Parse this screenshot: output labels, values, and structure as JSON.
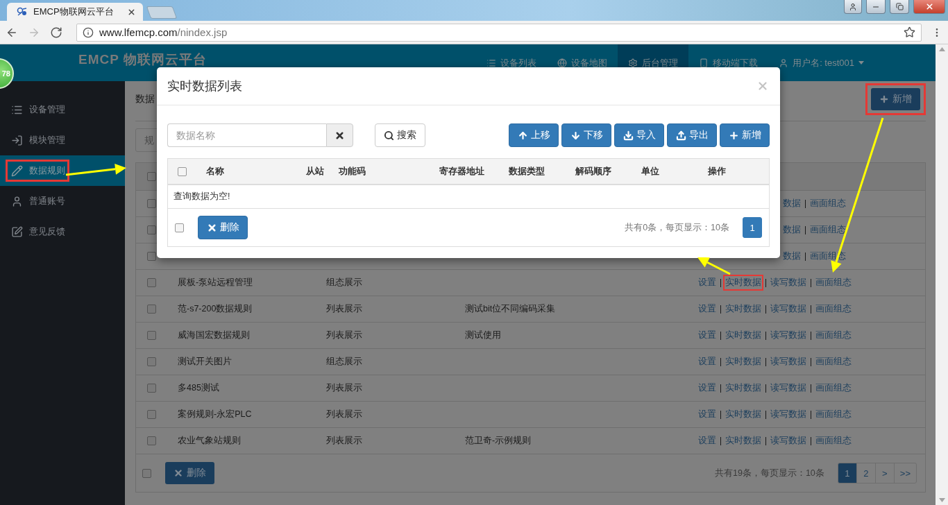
{
  "browser": {
    "tab": {
      "title": "EMCP物联网云平台"
    },
    "nav_buttons": [
      {
        "kind": "back",
        "disabled": false
      },
      {
        "kind": "forward",
        "disabled": true
      },
      {
        "kind": "reload",
        "disabled": false
      }
    ],
    "address": {
      "host": "www.lfemcp.com",
      "path": "/nindex.jsp"
    }
  },
  "floating_badge": "78",
  "navbar": {
    "logo": "EMCP 物联网云平台",
    "items": [
      {
        "kind": "list",
        "label": "设备列表",
        "selected": false
      },
      {
        "kind": "map",
        "label": "设备地图",
        "selected": false
      },
      {
        "kind": "admin",
        "label": "后台管理",
        "selected": true
      },
      {
        "kind": "mobile",
        "label": "移动端下载",
        "selected": false
      },
      {
        "kind": "user",
        "label": "用户名: test001",
        "selected": false
      }
    ]
  },
  "sidebar": {
    "items": [
      {
        "kind": "list",
        "label": "设备管理",
        "selected": false,
        "annotated": false
      },
      {
        "kind": "module",
        "label": "模块管理",
        "selected": false,
        "annotated": false
      },
      {
        "kind": "rule",
        "label": "数据规则",
        "selected": true,
        "annotated": true
      },
      {
        "kind": "account",
        "label": "普通账号",
        "selected": false,
        "annotated": false
      },
      {
        "kind": "feedback",
        "label": "意见反馈",
        "selected": false,
        "annotated": false
      }
    ]
  },
  "page": {
    "title": "数据",
    "filter_placeholder": "规",
    "add_button": {
      "label": "新增",
      "annotated": true
    },
    "table": {
      "select_all_checked": false,
      "rows": [
        {
          "kind": "covered",
          "checked": false,
          "ops": [
            {
              "label": "数据",
              "annotated": false
            },
            {
              "label": "画面组态",
              "annotated": false
            }
          ]
        },
        {
          "kind": "covered",
          "checked": false,
          "ops": [
            {
              "label": "数据",
              "annotated": false
            },
            {
              "label": "画面组态",
              "annotated": false
            }
          ]
        },
        {
          "kind": "covered",
          "checked": false,
          "ops": [
            {
              "label": "数据",
              "annotated": false
            },
            {
              "label": "画面组态",
              "annotated": false
            }
          ]
        },
        {
          "kind": "full",
          "checked": false,
          "name": "展板-泵站远程管理",
          "type": "组态展示",
          "ops": [
            {
              "label": "设置",
              "annotated": false
            },
            {
              "label": "实时数据",
              "annotated": true
            },
            {
              "label": "读写数据",
              "annotated": false
            },
            {
              "label": "画面组态",
              "annotated": false
            }
          ]
        },
        {
          "kind": "full",
          "checked": false,
          "name": "范-s7-200数据规则",
          "type": "列表展示",
          "note": "测试bit位不同编码采集",
          "ops": [
            {
              "label": "设置",
              "annotated": false
            },
            {
              "label": "实时数据",
              "annotated": false
            },
            {
              "label": "读写数据",
              "annotated": false
            },
            {
              "label": "画面组态",
              "annotated": false
            }
          ]
        },
        {
          "kind": "full",
          "checked": false,
          "name": "威海国宏数据规则",
          "type": "列表展示",
          "note": "测试使用",
          "ops": [
            {
              "label": "设置",
              "annotated": false
            },
            {
              "label": "实时数据",
              "annotated": false
            },
            {
              "label": "读写数据",
              "annotated": false
            },
            {
              "label": "画面组态",
              "annotated": false
            }
          ]
        },
        {
          "kind": "full",
          "checked": false,
          "name": "测试开关图片",
          "type": "组态展示",
          "ops": [
            {
              "label": "设置",
              "annotated": false
            },
            {
              "label": "实时数据",
              "annotated": false
            },
            {
              "label": "读写数据",
              "annotated": false
            },
            {
              "label": "画面组态",
              "annotated": false
            }
          ]
        },
        {
          "kind": "full",
          "checked": false,
          "name": "多485测试",
          "type": "列表展示",
          "ops": [
            {
              "label": "设置",
              "annotated": false
            },
            {
              "label": "实时数据",
              "annotated": false
            },
            {
              "label": "读写数据",
              "annotated": false
            },
            {
              "label": "画面组态",
              "annotated": false
            }
          ]
        },
        {
          "kind": "full",
          "checked": false,
          "name": "案例规则-永宏PLC",
          "type": "列表展示",
          "ops": [
            {
              "label": "设置",
              "annotated": false
            },
            {
              "label": "实时数据",
              "annotated": false
            },
            {
              "label": "读写数据",
              "annotated": false
            },
            {
              "label": "画面组态",
              "annotated": false
            }
          ]
        },
        {
          "kind": "full",
          "checked": false,
          "name": "农业气象站规则",
          "type": "列表展示",
          "note": "范卫奇-示例规则",
          "ops": [
            {
              "label": "设置",
              "annotated": false
            },
            {
              "label": "实时数据",
              "annotated": false
            },
            {
              "label": "读写数据",
              "annotated": false
            },
            {
              "label": "画面组态",
              "annotated": false
            }
          ]
        }
      ],
      "footer_checked": false,
      "delete_button": "删除",
      "summary": "共有19条，每页显示：10条",
      "pages": [
        {
          "label": "1",
          "selected": true
        },
        {
          "label": "2",
          "selected": false
        },
        {
          "label": ">",
          "selected": false
        },
        {
          "label": ">>",
          "selected": false
        }
      ]
    }
  },
  "modal": {
    "title": "实时数据列表",
    "search": {
      "placeholder": "数据名称"
    },
    "search_button": "搜索",
    "toolbar": [
      {
        "kind": "up",
        "label": "上移"
      },
      {
        "kind": "down",
        "label": "下移"
      },
      {
        "kind": "import",
        "label": "导入"
      },
      {
        "kind": "export",
        "label": "导出"
      },
      {
        "kind": "add",
        "label": "新增"
      }
    ],
    "select_all_checked": false,
    "columns": [
      "名称",
      "从站",
      "功能码",
      "寄存器地址",
      "数据类型",
      "解码顺序",
      "单位",
      "操作"
    ],
    "empty_text": "查询数据为空!",
    "footer_checked": false,
    "delete_button": "删除",
    "summary": "共有0条，每页显示：10条",
    "pages": [
      {
        "label": "1",
        "selected": true
      }
    ]
  }
}
